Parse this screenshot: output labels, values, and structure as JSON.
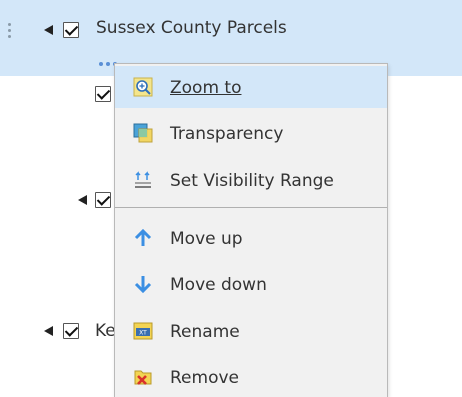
{
  "layers": {
    "top_layer_title": "Sussex County Parcels",
    "partial_layer_label": "Ke"
  },
  "context_menu": {
    "items": [
      {
        "label": "Zoom to",
        "icon": "zoom-to-icon"
      },
      {
        "label": "Transparency",
        "icon": "transparency-icon"
      },
      {
        "label": "Set Visibility Range",
        "icon": "visibility-range-icon"
      },
      {
        "label": "Move up",
        "icon": "arrow-up-icon"
      },
      {
        "label": "Move down",
        "icon": "arrow-down-icon"
      },
      {
        "label": "Rename",
        "icon": "rename-icon"
      },
      {
        "label": "Remove",
        "icon": "remove-icon"
      }
    ]
  },
  "colors": {
    "selected_row": "#d3e7f9",
    "menu_bg": "#f1f1f1",
    "arrow_blue": "#3b8fe3",
    "more_dots": "#5a8fd6"
  }
}
